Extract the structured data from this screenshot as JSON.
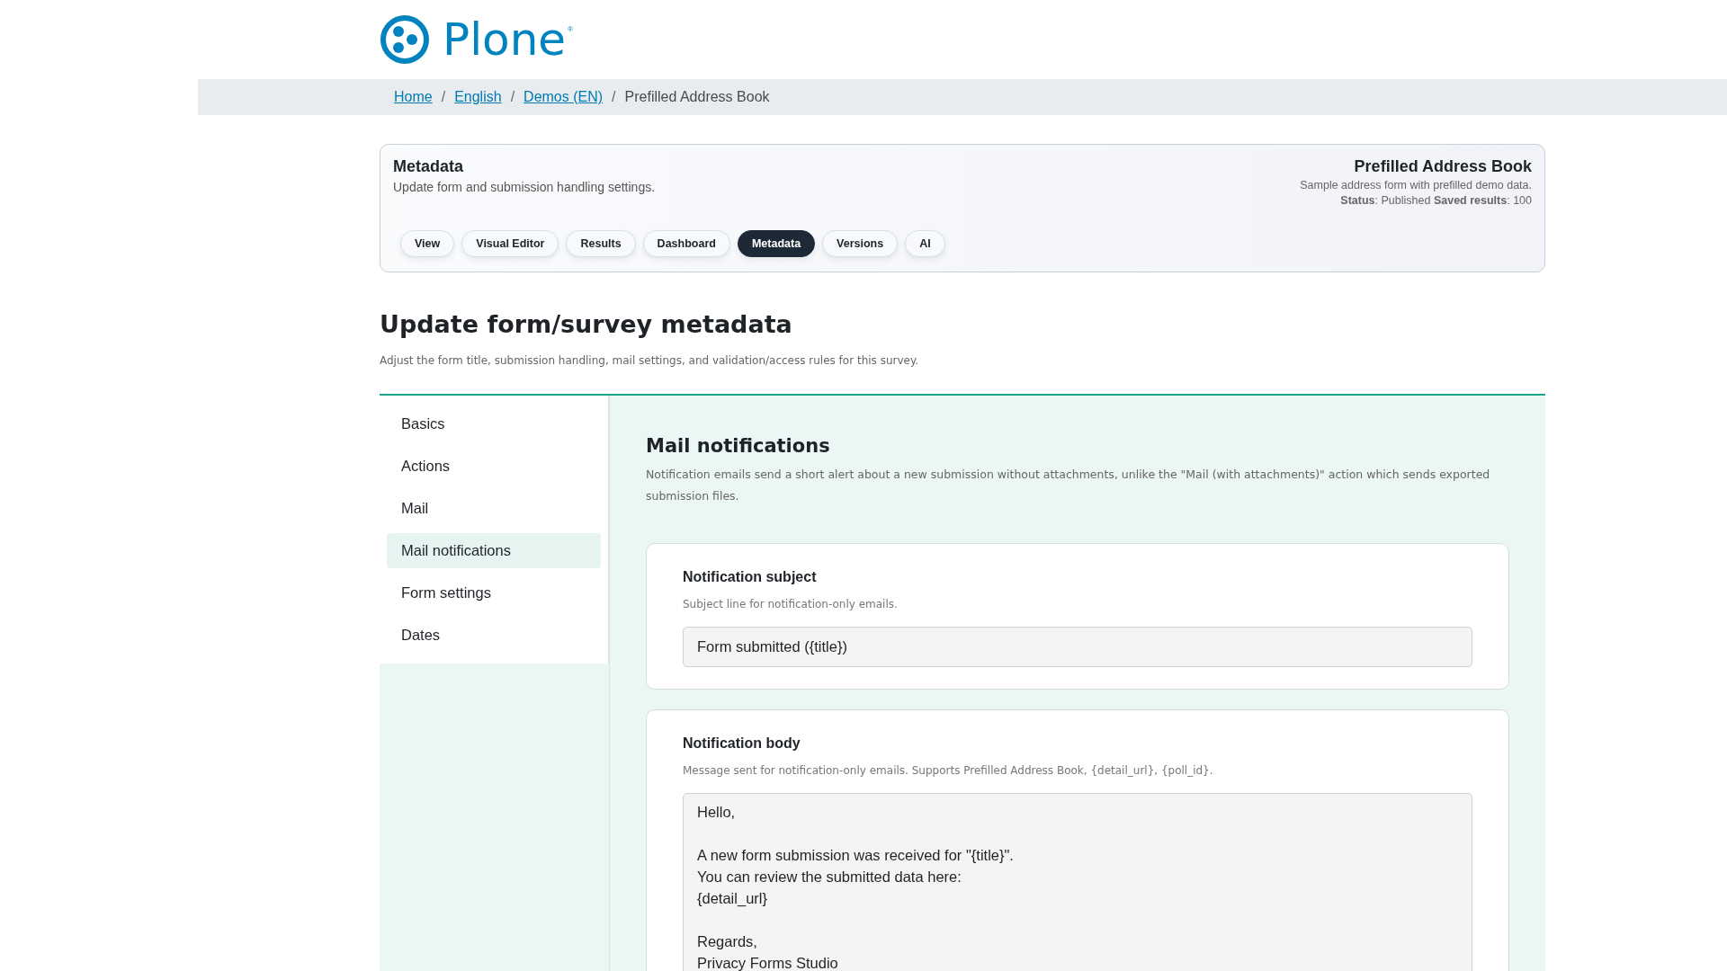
{
  "logo": {
    "text": "Plone",
    "mark": "®"
  },
  "breadcrumb_separator": "/",
  "breadcrumbs": [
    {
      "label": "Home",
      "link": true
    },
    {
      "label": "English",
      "link": true
    },
    {
      "label": "Demos (EN)",
      "link": true
    },
    {
      "label": "Prefilled Address Book",
      "link": false
    }
  ],
  "header": {
    "title": "Metadata",
    "subtitle": "Update form and submission handling settings.",
    "form_title": "Prefilled Address Book",
    "form_description": "Sample address form with prefilled demo data.",
    "status": "**Status**: Published **Saved results**: 100"
  },
  "tabs": [
    {
      "label": "View",
      "selected": false
    },
    {
      "label": "Visual Editor",
      "selected": false
    },
    {
      "label": "Results",
      "selected": false
    },
    {
      "label": "Dashboard",
      "selected": false
    },
    {
      "label": "Metadata",
      "selected": true
    },
    {
      "label": "Versions",
      "selected": false
    },
    {
      "label": "AI",
      "selected": false
    }
  ],
  "page": {
    "title": "Update form/survey metadata",
    "description": "Adjust the form title, submission handling, mail settings, and validation/access rules for this survey."
  },
  "sidebar": {
    "items": [
      {
        "label": "Basics",
        "selected": false
      },
      {
        "label": "Actions",
        "selected": false
      },
      {
        "label": "Mail",
        "selected": false
      },
      {
        "label": "Mail notifications",
        "selected": true
      },
      {
        "label": "Form settings",
        "selected": false
      },
      {
        "label": "Dates",
        "selected": false
      }
    ]
  },
  "section": {
    "title": "Mail notifications",
    "description": "Notification emails send a short alert about a new submission without attachments, unlike the \"Mail (with attachments)\" action which sends exported submission files."
  },
  "fields": [
    {
      "kind": "input",
      "label": "Notification subject",
      "help": "Subject line for notification-only emails.",
      "value": "Form submitted ({title})"
    },
    {
      "kind": "textarea",
      "label": "Notification body",
      "help": "Message sent for notification-only emails. Supports Prefilled Address Book, {detail_url}, {poll_id}.",
      "value": "Hello,\n\nA new form submission was received for \"{title}\".\nYou can review the submitted data here:\n{detail_url}\n\nRegards,\nPrivacy Forms Studio"
    }
  ]
}
